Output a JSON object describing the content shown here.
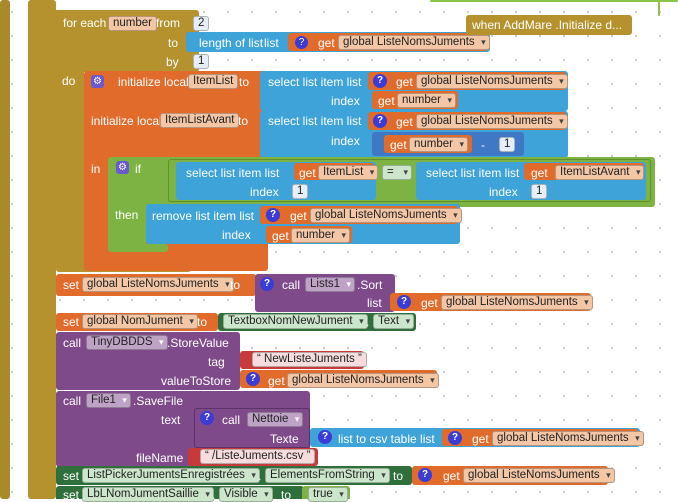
{
  "header": {
    "for_each": "for each",
    "number_var": "number",
    "from": "from",
    "from_val": "2",
    "to": "to",
    "length_of_list": "length of list",
    "list": "list",
    "get": "get",
    "global_liste": "global ListeNomsJuments",
    "by": "by",
    "by_val": "1",
    "do": "do"
  },
  "event_label": "when  AddMare .Initialize d...",
  "init1": {
    "label": "initialize local",
    "var": "ItemList",
    "to": "to",
    "select": "select list item  list",
    "get": "get",
    "list_var": "global ListeNomsJuments",
    "index": "index",
    "index_var": "number"
  },
  "init2": {
    "label": "initialize local",
    "var": "ItemListAvant",
    "to": "to",
    "select": "select list item  list",
    "get": "get",
    "list_var": "global ListeNomsJuments",
    "index": "index",
    "index_var": "number",
    "minus": "-",
    "minus_val": "1"
  },
  "ifblock": {
    "in": "in",
    "if": "if",
    "select_a": "select list item  list",
    "get": "get",
    "item_list": "ItemList",
    "index": "index",
    "one": "1",
    "eq": "=",
    "select_b": "select list item  list",
    "item_list_avant": "ItemListAvant",
    "then": "then",
    "remove": "remove list item  list",
    "global_liste": "global ListeNomsJuments",
    "number": "number"
  },
  "set_sort": {
    "set": "set",
    "var": "global ListeNomsJuments",
    "to": "to",
    "call": "call",
    "comp": "Lists1",
    "method": ".Sort",
    "list": "list",
    "get": "get",
    "arg": "global ListeNomsJuments"
  },
  "set_nom": {
    "set": "set",
    "var": "global NomJument",
    "to": "to",
    "comp": "TextboxNomNewJument",
    "dot": ".",
    "prop": "Text"
  },
  "store": {
    "call": "call",
    "comp": "TinyDBDDS",
    "method": ".StoreValue",
    "tag": "tag",
    "tag_val": "NewListeJuments",
    "value_to_store": "valueToStore",
    "get": "get",
    "arg": "global ListeNomsJuments"
  },
  "savefile": {
    "call": "call",
    "comp": "File1",
    "method": ".SaveFile",
    "text": "text",
    "call2": "call",
    "proc": "Nettoie",
    "texte": "Texte",
    "csv": "list to csv table  list",
    "get": "get",
    "arg": "global ListeNomsJuments",
    "filename": "fileName",
    "filename_val": "/ListeJuments.csv"
  },
  "set_picker": {
    "set": "set",
    "comp": "ListPickerJumentsEnregistrées",
    "dot": ".",
    "prop": "ElementsFromString",
    "to": "to",
    "get": "get",
    "arg": "global ListeNomsJuments"
  },
  "set_lbl": {
    "set": "set",
    "comp": "LbLNomJumentSaillie",
    "dot": ".",
    "prop": "Visible",
    "to": "to",
    "val": "true"
  },
  "colors": {
    "control": "#b5922e",
    "variable": "#e06b2b",
    "list": "#3ea3d9",
    "math": "#3f78c4",
    "text": "#c73a3a",
    "component": "#7e4a8a",
    "setter": "#2f6f3b",
    "logic": "#7cb342"
  }
}
